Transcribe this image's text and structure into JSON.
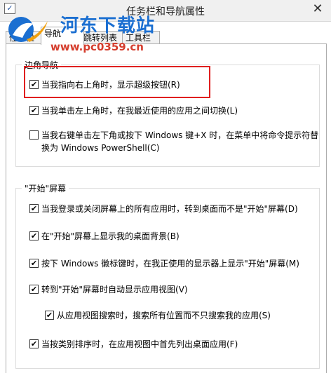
{
  "window": {
    "title": "任务栏和导航属性",
    "close_glyph": "✕",
    "app_icon_glyph": "✓"
  },
  "watermark": {
    "title": "河东下载站",
    "url": "www.pc0359.cn"
  },
  "tabs": [
    {
      "label": "任务栏",
      "active": false
    },
    {
      "label": "导航",
      "active": true
    },
    {
      "label": "跳转列表",
      "active": false
    },
    {
      "label": "工具栏",
      "active": false
    }
  ],
  "corner_nav": {
    "legend": "边角导航",
    "options": [
      {
        "label": "当我指向右上角时，显示超级按钮(R)",
        "checked": true
      },
      {
        "label": "当我单击左上角时，在我最近使用的应用之间切换(L)",
        "checked": true
      },
      {
        "label": "当我右键单击左下角或按下 Windows 键+X 时，在菜单中将命令提示符替换为 Windows PowerShell(C)",
        "checked": false
      }
    ]
  },
  "start_screen": {
    "legend": "\"开始\"屏幕",
    "options": [
      {
        "label": "当我登录或关闭屏幕上的所有应用时，转到桌面而不是\"开始\"屏幕(D)",
        "checked": true
      },
      {
        "label": "在\"开始\"屏幕上显示我的桌面背景(B)",
        "checked": true
      },
      {
        "label": "按下 Windows 徽标键时，在我正使用的显示器上显示\"开始\"屏幕(M)",
        "checked": true
      },
      {
        "label": "转到\"开始\"屏幕时自动显示应用视图(V)",
        "checked": true
      },
      {
        "label": "从应用视图搜索时，搜索所有位置而不只搜索我的应用(S)",
        "checked": true
      },
      {
        "label": "当按类别排序时，在应用视图中首先列出桌面应用(F)",
        "checked": true
      }
    ]
  },
  "check_glyph": "✔",
  "colors": {
    "highlight": "#e01f1f",
    "watermark_title": "#1b6fd1",
    "watermark_url": "#d53d2d"
  }
}
